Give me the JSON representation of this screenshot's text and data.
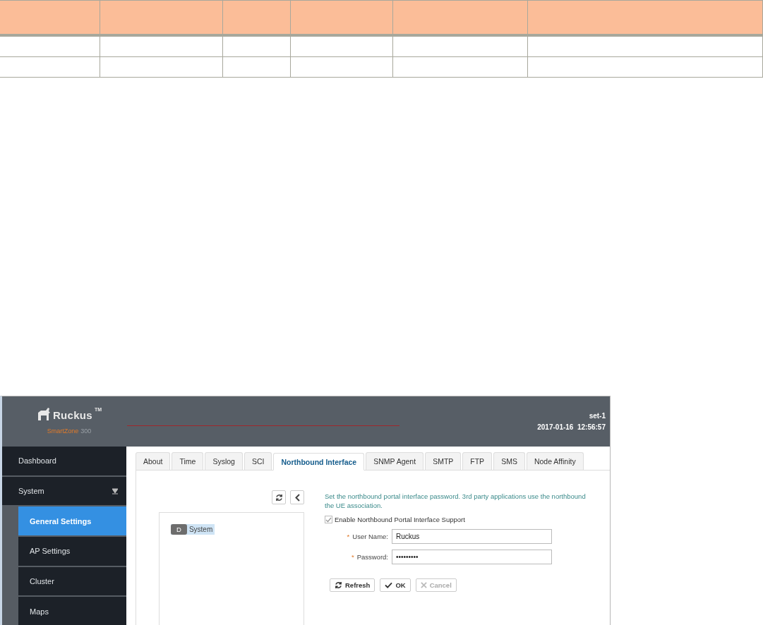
{
  "header": {
    "brand": "Ruckus",
    "trademark": "TM",
    "product": "SmartZone",
    "model": "300",
    "host": "set-1",
    "datetime": "2017-01-16  12:56:57"
  },
  "sidebar": {
    "items": [
      {
        "label": "Dashboard",
        "expanded": false
      },
      {
        "label": "System",
        "expanded": true,
        "children": [
          {
            "label": "General Settings",
            "selected": true
          },
          {
            "label": "AP Settings",
            "selected": false
          },
          {
            "label": "Cluster",
            "selected": false
          },
          {
            "label": "Maps",
            "selected": false
          }
        ]
      }
    ]
  },
  "tabs": [
    {
      "label": "About",
      "selected": false
    },
    {
      "label": "Time",
      "selected": false
    },
    {
      "label": "Syslog",
      "selected": false
    },
    {
      "label": "SCI",
      "selected": false
    },
    {
      "label": "Northbound Interface",
      "selected": true
    },
    {
      "label": "SNMP Agent",
      "selected": false
    },
    {
      "label": "SMTP",
      "selected": false
    },
    {
      "label": "FTP",
      "selected": false
    },
    {
      "label": "SMS",
      "selected": false
    },
    {
      "label": "Node Affinity",
      "selected": false
    }
  ],
  "tree": {
    "items": [
      {
        "badge": "D",
        "label": "System",
        "selected": true
      }
    ]
  },
  "form": {
    "description": [
      "Set the northbound portal interface password. 3rd party applications use the northbound",
      "the UE association."
    ],
    "checkbox": {
      "label": "Enable Northbound Portal Interface Support",
      "checked": true
    },
    "fields": [
      {
        "label": "User Name:",
        "required_mark": "*",
        "value": "Ruckus"
      },
      {
        "label": "Password:",
        "required_mark": "*",
        "value": "•••••••••"
      }
    ],
    "buttons": [
      {
        "label": "Refresh",
        "kind": "refresh",
        "disabled": false
      },
      {
        "label": "OK",
        "kind": "ok",
        "disabled": false
      },
      {
        "label": "Cancel",
        "kind": "cancel",
        "disabled": true
      }
    ]
  }
}
